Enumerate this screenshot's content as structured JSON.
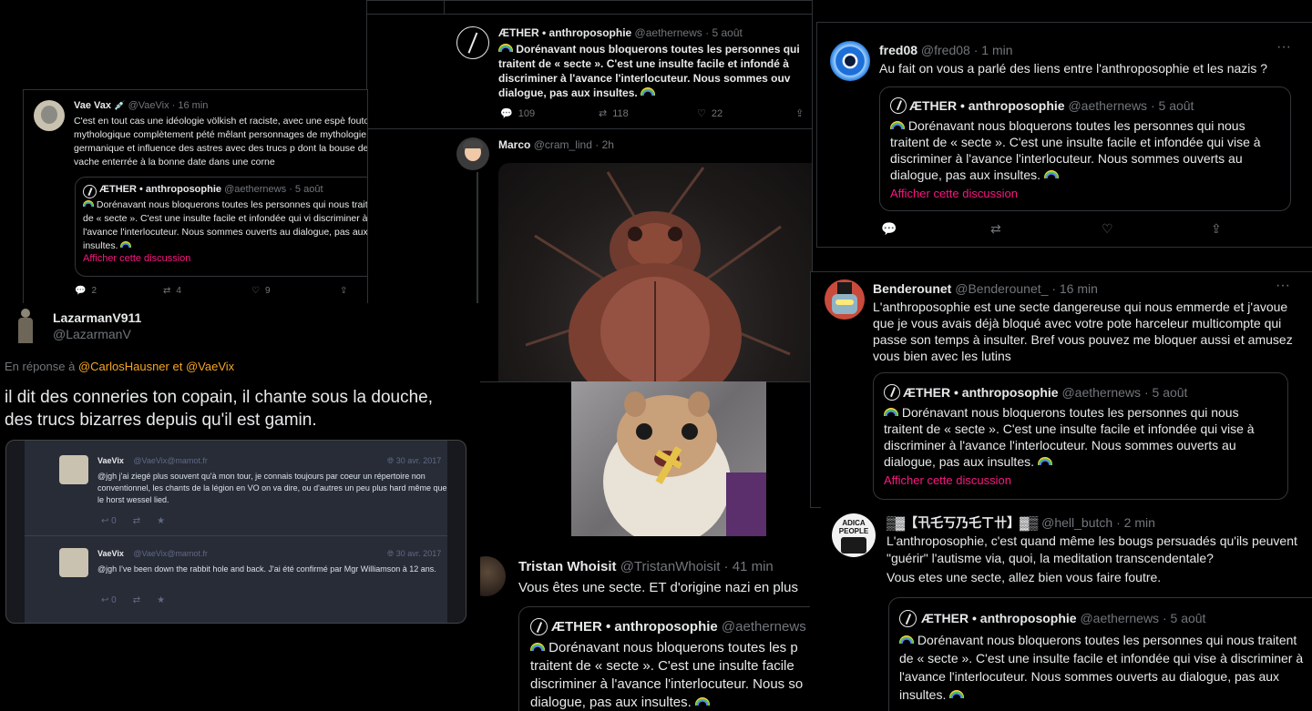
{
  "ether_tweet": {
    "name": "ÆTHER • anthroposophie",
    "handle": "@aethernews",
    "date": "5 août",
    "text": "Dorénavant nous bloquerons toutes les personnes qui nous traitent de « secte ». C'est une insulte facile et infondée qui vise à discriminer à l'avance l'interlocuteur. Nous sommes ouverts au dialogue, pas aux insultes.",
    "show_thread": "Afficher cette discussion"
  },
  "vaevix": {
    "name": "Vae Vax",
    "handle": "@VaeVix",
    "time": "16 min",
    "text": "C'est en tout cas une idéologie völkish et raciste, avec une espè foutoir mythologique complètement pété mêlant personnages de mythologie germanique et influence des astres avec des trucs p dont la bouse de vache enterrée à la bonne date dans une corne",
    "quote_text": "Dorénavant nous bloquerons toutes les personnes qui nous traitent de « secte ». C'est une insulte facile et infondée qui vi discriminer à l'avance l'interlocuteur. Nous sommes ouverts au dialogue, pas aux insultes.",
    "replies": "2",
    "retweets": "4",
    "likes": "9"
  },
  "main_ether": {
    "name": "ÆTHER • anthroposophie",
    "handle": "@aethernews",
    "date": "5 août",
    "text": "Dorénavant nous bloquerons toutes les personnes qui traitent de « secte ». C'est une insulte facile et infondé à discriminer à l'avance l'interlocuteur. Nous sommes ouv dialogue, pas aux insultes.",
    "replies": "109",
    "retweets": "118",
    "likes": "22"
  },
  "marco": {
    "name": "Marco",
    "handle": "@cram_lind",
    "time": "2h"
  },
  "fred": {
    "name": "fred08",
    "handle": "@fred08",
    "time": "1 min",
    "text": "Au fait on vous a parlé des liens entre l'anthroposophie et les nazis ?",
    "more": "···"
  },
  "bender": {
    "name": "Benderounet",
    "handle": "@Benderounet_",
    "time": "16 min",
    "text": "L'anthroposophie est une secte dangereuse qui nous emmerde et j'avoue que je vous avais déjà bloqué avec votre pote harceleur multicompte qui passe son temps à insulter. Bref vous pouvez me bloquer aussi et amusez vous bien avec les lutins",
    "more": "···"
  },
  "lazarman": {
    "name": "LazarmanV911",
    "handle": "@LazarmanV",
    "reply_prefix": "En réponse à",
    "reply_user1": "@CarlosHausner",
    "reply_and": "et",
    "reply_user2": "@VaeVix",
    "text": "il dit des conneries ton copain, il chante sous la douche, des trucs bizarres depuis qu'il est gamin."
  },
  "mastodon": {
    "posts": [
      {
        "name": "VaeVix",
        "handle": "@VaeVix@mamot.fr",
        "date": "30 avr. 2017",
        "text": "@jgh j'ai ziegé plus souvent qu'à mon tour, je connais toujours par coeur un répertoire non conventionnel, les chants de la légion en VO on va dire, ou d'autres un peu plus hard même que le horst wessel lied.",
        "count": "0"
      },
      {
        "name": "VaeVix",
        "handle": "@VaeVix@mamot.fr",
        "date": "30 avr. 2017",
        "text": "@jgh I've been down the rabbit hole and back. J'ai été confirmé par Mgr Williamson à 12 ans.",
        "count": "0"
      }
    ]
  },
  "tristan": {
    "name": "Tristan Whoisit",
    "handle": "@TristanWhoisit",
    "time": "41 min",
    "text": "Vous êtes une secte. ET d'origine nazi en plus",
    "quote_name": "ÆTHER • anthroposophie",
    "quote_handle": "@aethernews",
    "quote_text": "Dorénavant nous bloquerons toutes les p traitent de « secte ». C'est une insulte facile discriminer à l'avance l'interlocuteur. Nous so dialogue, pas aux insultes."
  },
  "hellbutch": {
    "name": "▒▓【卂乇丂乃乇ㄒ卄】▓▒",
    "handle": "@hell_butch",
    "time": "2 min",
    "avatar_text": "ADICA PEOPLE",
    "text1": "L'anthroposophie, c'est quand même les bougs persuadés qu'ils peuvent \"guérir\" l'autisme via, quoi, la meditation transcendentale?",
    "text2": "Vous etes une secte, allez bien vous faire foutre.",
    "quote_text": "Dorénavant nous bloquerons toutes les personnes qui nous traitent de « secte ». C'est une insulte facile et infondée qui vise à discriminer à l'avance l'interlocuteur. Nous sommes ouverts au dialogue, pas aux insultes."
  },
  "colors": {
    "background": "#000000",
    "text": "#e7e9ea",
    "muted": "#71767b",
    "link_red": "#f91880",
    "link_orange": "#f5a623",
    "mastodon_bg": "#282c37"
  }
}
